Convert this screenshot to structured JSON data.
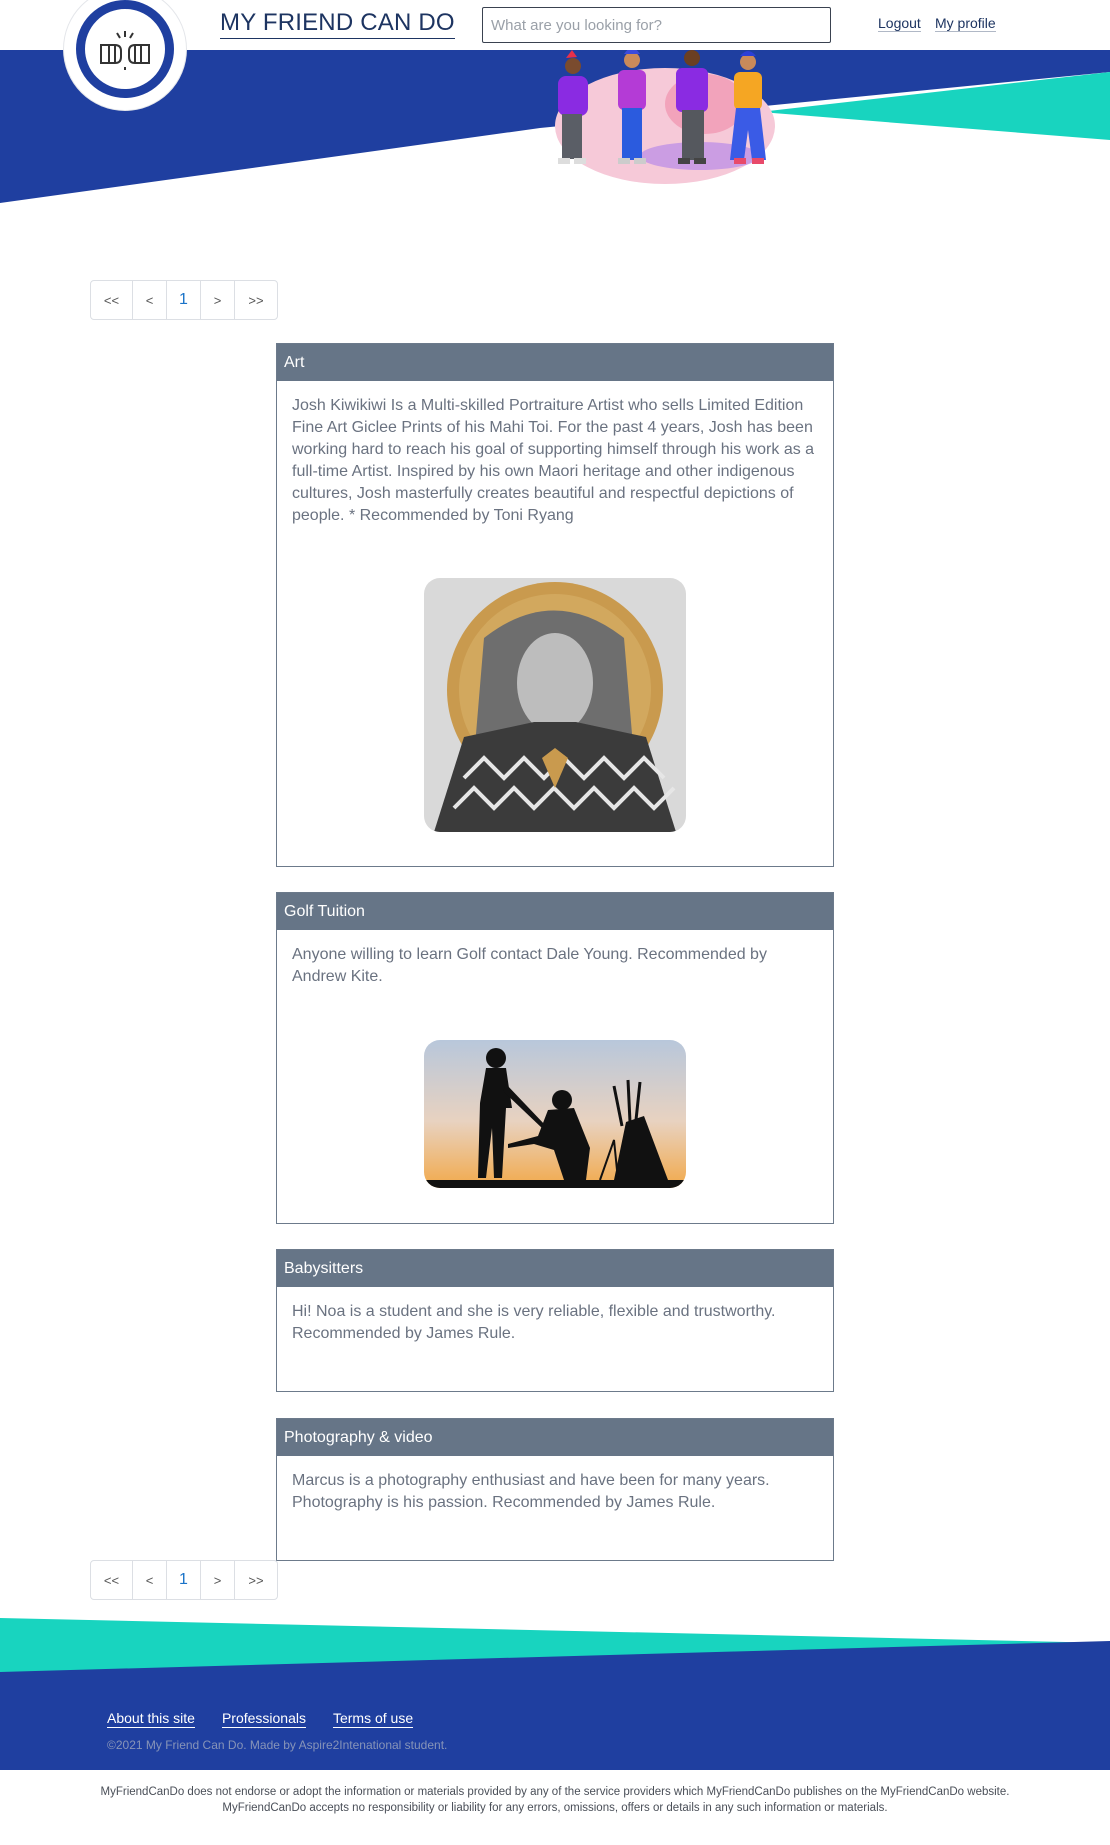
{
  "header": {
    "site_title": "MY FRIEND CAN DO",
    "search_placeholder": "What are you looking for?",
    "search_value": "",
    "nav": [
      {
        "label": "Logout"
      },
      {
        "label": "My profile"
      }
    ]
  },
  "colors": {
    "primary_blue": "#1f3fa0",
    "teal": "#18d4bf",
    "card_header": "#667587",
    "active_page": "#1a73c8"
  },
  "pagination": {
    "first": "<<",
    "prev": "<",
    "current": "1",
    "next": ">",
    "last": ">>"
  },
  "cards": [
    {
      "title": "Art",
      "body": "Josh Kiwikiwi Is a Multi-skilled Portraiture Artist who sells Limited Edition Fine Art Giclee Prints of his Mahi Toi. For the past 4 years, Josh has been working hard to reach his goal of supporting himself through his work as a full-time Artist. Inspired by his own Maori heritage and other indigenous cultures, Josh masterfully creates beautiful and respectful depictions of people. * Recommended by Toni Ryang"
    },
    {
      "title": "Golf Tuition",
      "body": "Anyone willing to learn Golf contact Dale Young. Recommended by Andrew Kite."
    },
    {
      "title": "Babysitters",
      "body": "Hi! Noa is a student and she is very reliable, flexible and trustworthy. Recommended by James Rule."
    },
    {
      "title": "Photography & video",
      "body": "Marcus is a photography enthusiast and have been for many years. Photography is his passion. Recommended by James Rule."
    }
  ],
  "footer": {
    "links": [
      {
        "label": "About this site"
      },
      {
        "label": "Professionals"
      },
      {
        "label": "Terms of use"
      }
    ],
    "copyright": "©2021 My Friend Can Do. Made by Aspire2Intenational student.",
    "disclaimer": "MyFriendCanDo does not endorse or adopt the information or materials provided by any of the service providers which MyFriendCanDo publishes on the MyFriendCanDo website. MyFriendCanDo accepts no responsibility or liability for any errors, omissions, offers or details in any such information or materials."
  }
}
